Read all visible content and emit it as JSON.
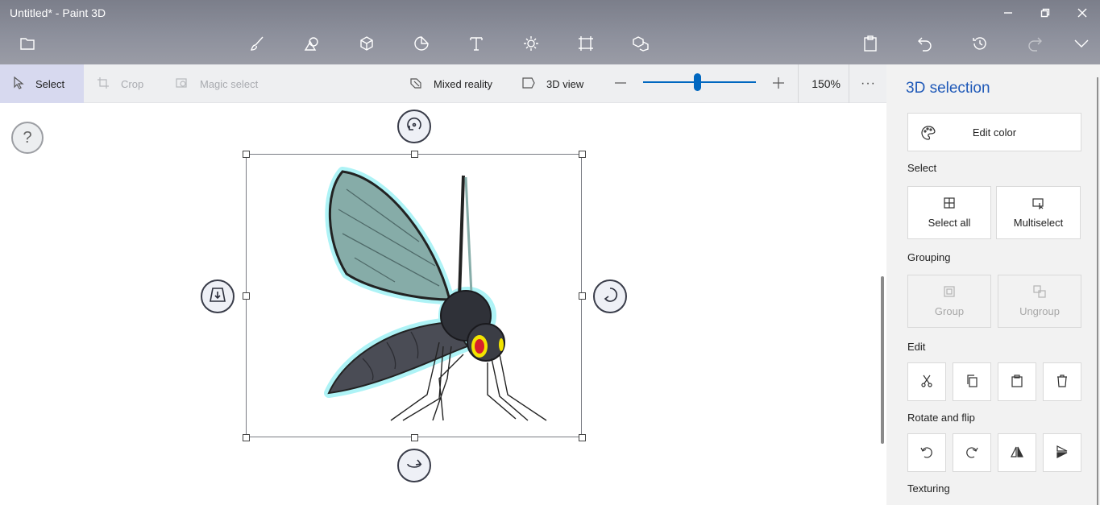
{
  "window": {
    "title": "Untitled* - Paint 3D"
  },
  "icons": {
    "menu": "folder-icon",
    "tools": [
      "brushes-icon",
      "2d-shapes-icon",
      "3d-shapes-icon",
      "stickers-icon",
      "text-icon",
      "effects-icon",
      "canvas-icon",
      "3d-library-icon"
    ],
    "right": [
      "paste-icon",
      "undo-icon",
      "history-icon",
      "redo-icon",
      "expand-icon"
    ]
  },
  "subtoolbar": {
    "select": "Select",
    "crop": "Crop",
    "magic_select": "Magic select",
    "mixed_reality": "Mixed reality",
    "view_3d": "3D view",
    "zoom": "150%",
    "zoom_level": 0.48
  },
  "canvas": {
    "help": "?"
  },
  "panel": {
    "title": "3D selection",
    "edit_color": "Edit color",
    "select_label": "Select",
    "select_all": "Select all",
    "multiselect": "Multiselect",
    "grouping_label": "Grouping",
    "group": "Group",
    "ungroup": "Ungroup",
    "edit_label": "Edit",
    "rotate_label": "Rotate and flip",
    "texturing_label": "Texturing"
  },
  "colors": {
    "accent": "#0067c0",
    "panel_title": "#1f59b8",
    "selection_tint": "#d7d9ef"
  }
}
